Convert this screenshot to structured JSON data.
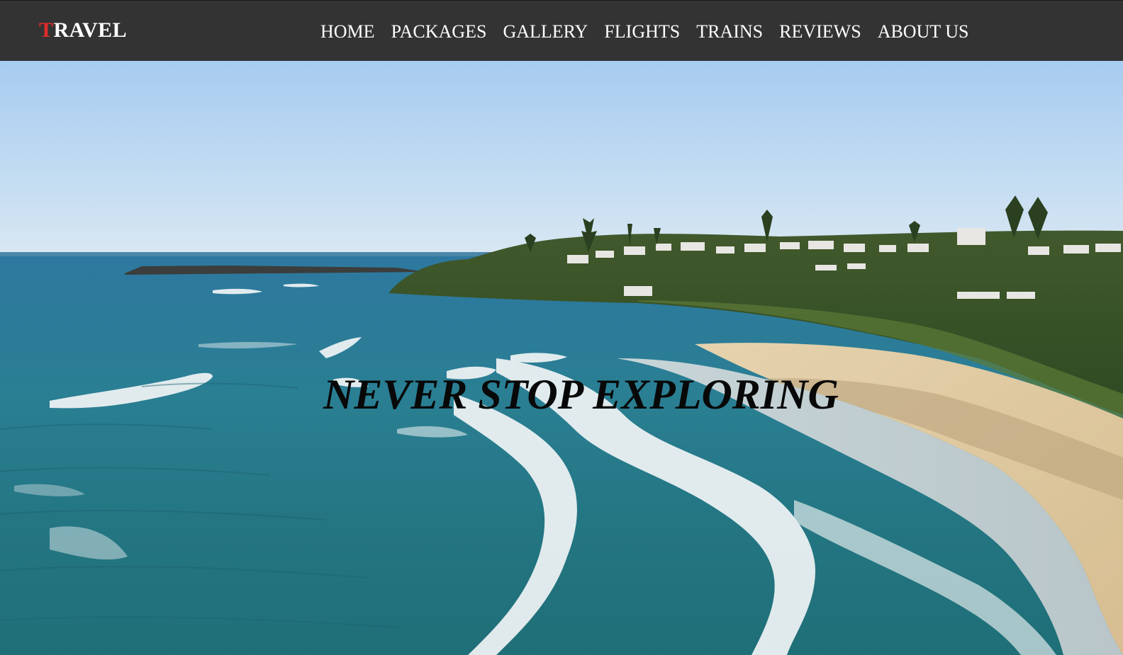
{
  "brand": {
    "first_letter": "T",
    "rest": "RAVEL",
    "accent_color": "#e02b2b"
  },
  "nav": {
    "items": [
      {
        "label": "HOME"
      },
      {
        "label": "PACKAGES"
      },
      {
        "label": "GALLERY"
      },
      {
        "label": "FLIGHTS"
      },
      {
        "label": "TRAINS"
      },
      {
        "label": "REVIEWS"
      },
      {
        "label": "ABOUT US"
      }
    ]
  },
  "hero": {
    "tagline": "NEVER STOP EXPLORING",
    "background": "coastal-beach-aerial-photo"
  },
  "colors": {
    "topbar": "#333333",
    "nav_text": "#ffffff",
    "tagline_text": "#080808"
  }
}
